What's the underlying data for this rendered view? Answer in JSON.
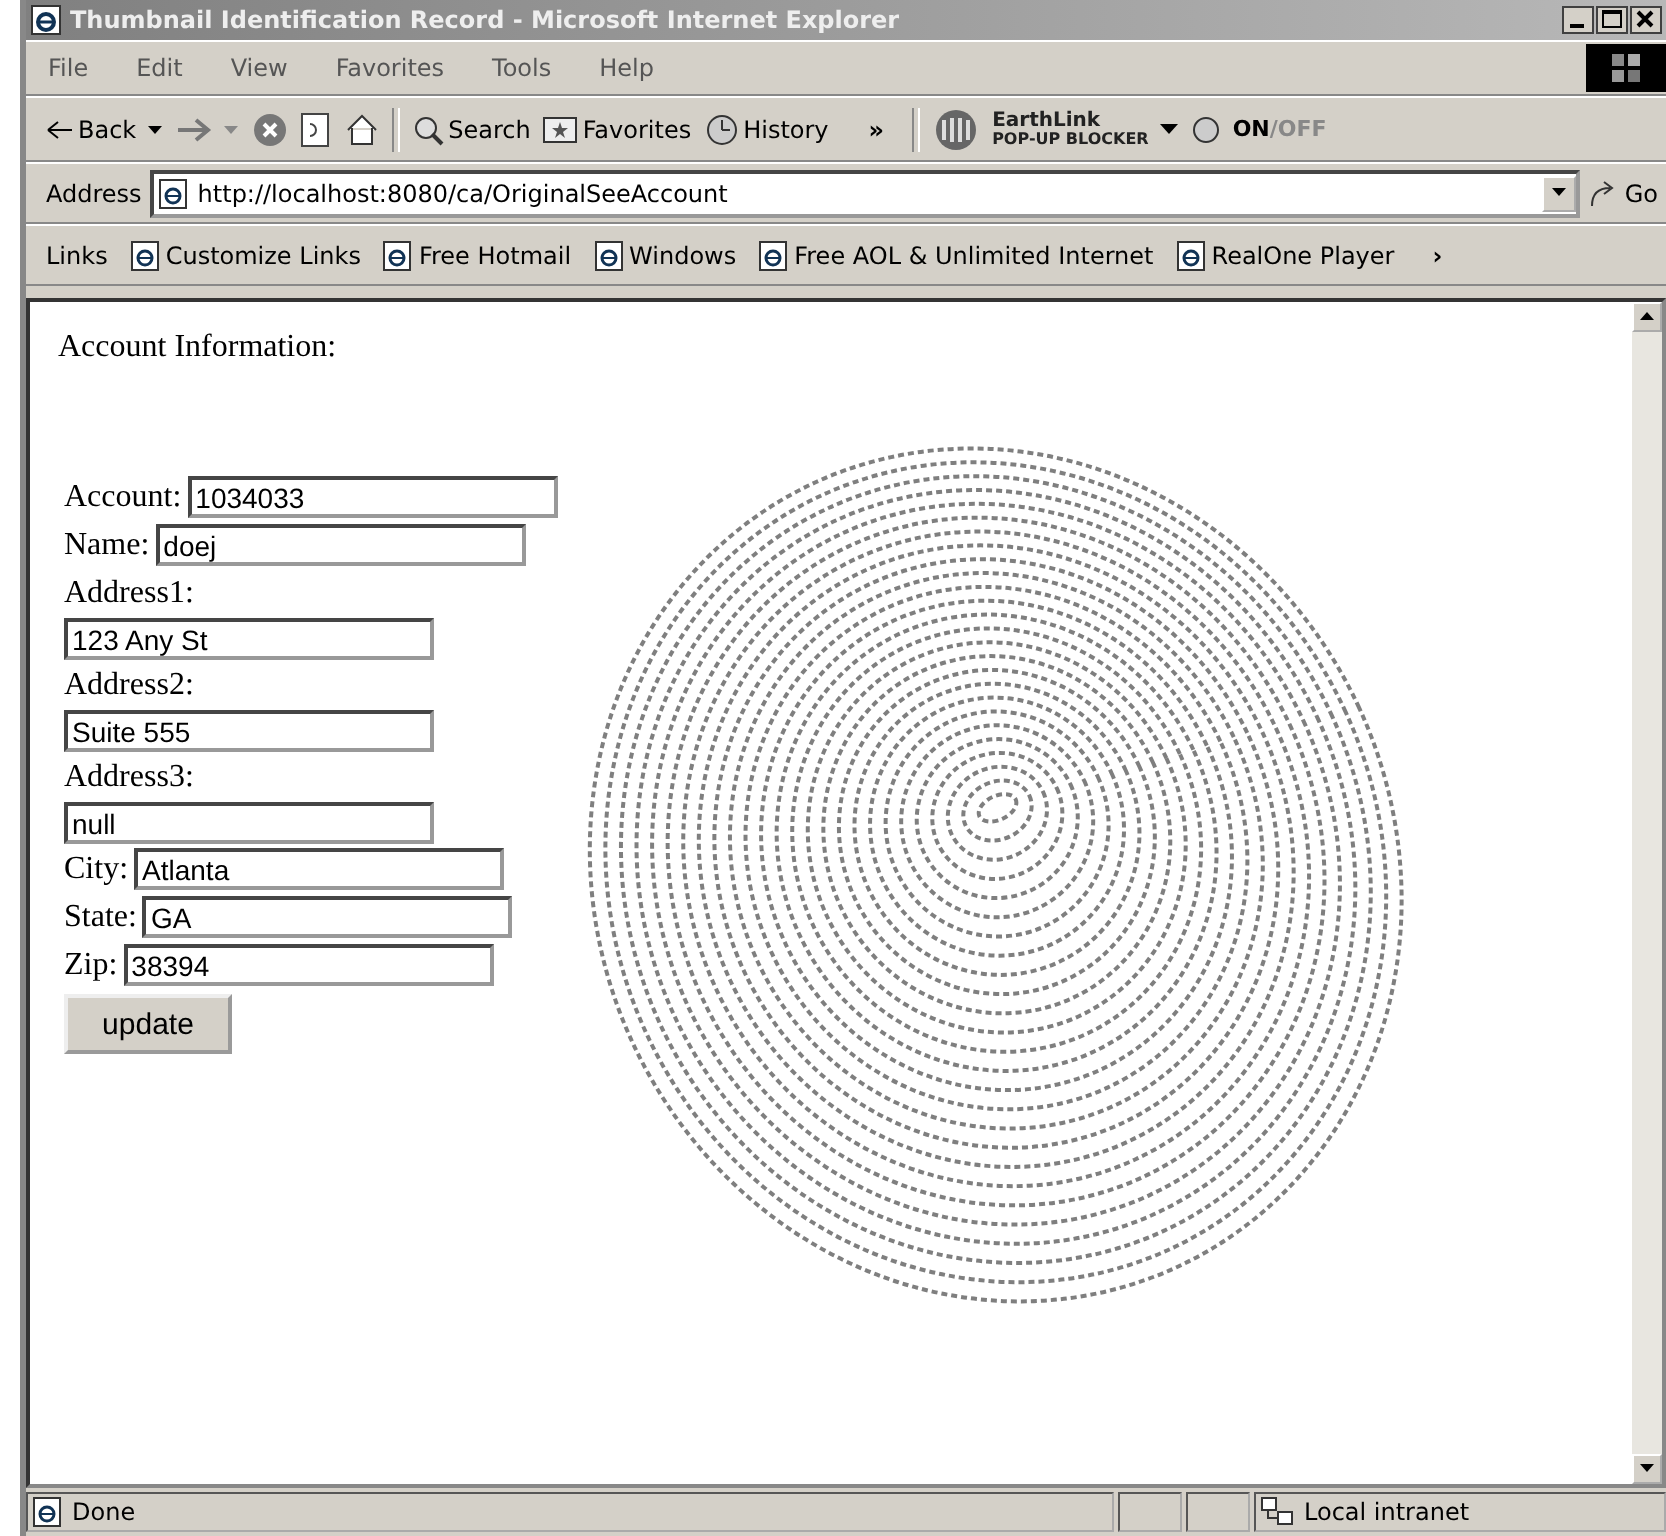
{
  "window": {
    "title": "Thumbnail Identification Record - Microsoft Internet Explorer"
  },
  "menu": [
    "File",
    "Edit",
    "View",
    "Favorites",
    "Tools",
    "Help"
  ],
  "toolbar": {
    "back": "Back",
    "buttons": [
      "Search",
      "Favorites",
      "History"
    ],
    "more": "»",
    "earthlink": {
      "brand": "EarthLink",
      "sub": "POP-UP BLOCKER",
      "on": "ON",
      "off": "/OFF"
    }
  },
  "address": {
    "label": "Address",
    "value": "http://localhost:8080/ca/OriginalSeeAccount",
    "go": "Go"
  },
  "links": {
    "label": "Links",
    "items": [
      "Customize Links",
      "Free Hotmail",
      "Windows",
      "Free AOL & Unlimited Internet",
      "RealOne Player"
    ],
    "more": "›"
  },
  "page": {
    "heading": "Account Information:",
    "fields": [
      {
        "label": "Account:",
        "value": "1034033",
        "kind": "inline"
      },
      {
        "label": "Name:",
        "value": "doej",
        "kind": "inline"
      },
      {
        "label": "Address1:",
        "value": "123 Any St",
        "kind": "stacked"
      },
      {
        "label": "Address2:",
        "value": "Suite 555",
        "kind": "stacked"
      },
      {
        "label": "Address3:",
        "value": "null",
        "kind": "stacked"
      },
      {
        "label": "City:",
        "value": "Atlanta",
        "kind": "inline"
      },
      {
        "label": "State:",
        "value": "GA",
        "kind": "inline"
      },
      {
        "label": "Zip:",
        "value": "38394",
        "kind": "inline"
      }
    ],
    "button": "update"
  },
  "status_bar": {
    "text": "Done",
    "zone": "Local intranet"
  }
}
